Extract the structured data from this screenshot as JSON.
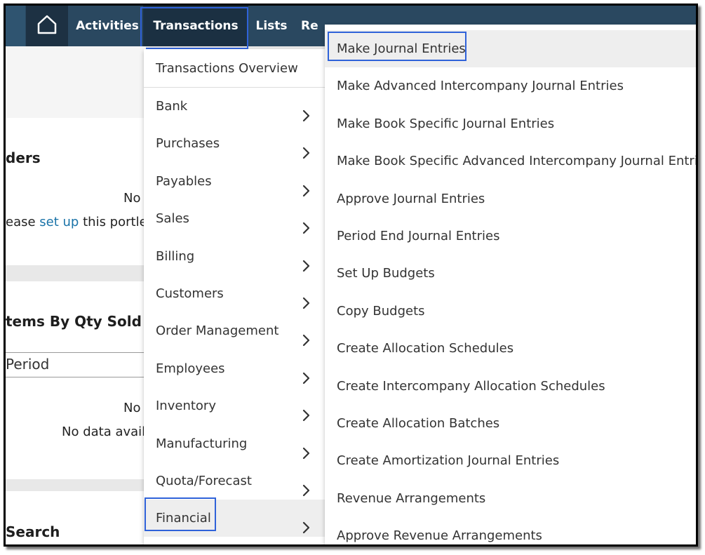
{
  "nav": {
    "items": [
      {
        "label": "Activities"
      },
      {
        "label": "Transactions"
      },
      {
        "label": "Lists"
      },
      {
        "label": "Re"
      }
    ]
  },
  "background": {
    "reminders_title": "ders",
    "no_text_1": "No",
    "setup_prefix": "ease",
    "setup_link": "set up",
    "setup_suffix": "this portlet b",
    "items_title": "tems By Qty Sold",
    "period_value": "Period",
    "no_text_2": "No",
    "no_data": "No data availa",
    "search_title": "Search"
  },
  "menu": {
    "overview": "Transactions Overview",
    "items": [
      {
        "label": "Bank"
      },
      {
        "label": "Purchases"
      },
      {
        "label": "Payables"
      },
      {
        "label": "Sales"
      },
      {
        "label": "Billing"
      },
      {
        "label": "Customers"
      },
      {
        "label": "Order Management"
      },
      {
        "label": "Employees"
      },
      {
        "label": "Inventory"
      },
      {
        "label": "Manufacturing"
      },
      {
        "label": "Quota/Forecast"
      },
      {
        "label": "Financial"
      }
    ]
  },
  "submenu": {
    "items": [
      {
        "label": "Make Journal Entries"
      },
      {
        "label": "Make Advanced Intercompany Journal Entries"
      },
      {
        "label": "Make Book Specific Journal Entries"
      },
      {
        "label": "Make Book Specific Advanced Intercompany Journal Entries"
      },
      {
        "label": "Approve Journal Entries"
      },
      {
        "label": "Period End Journal Entries"
      },
      {
        "label": "Set Up Budgets"
      },
      {
        "label": "Copy Budgets"
      },
      {
        "label": "Create Allocation Schedules"
      },
      {
        "label": "Create Intercompany Allocation Schedules"
      },
      {
        "label": "Create Allocation Batches"
      },
      {
        "label": "Create Amortization Journal Entries"
      },
      {
        "label": "Revenue Arrangements"
      },
      {
        "label": "Approve Revenue Arrangements"
      }
    ]
  },
  "colors": {
    "navbar": "#2a4860",
    "nav_active": "#1b3042",
    "highlight_border": "#2f62d9",
    "link": "#1a73a8"
  }
}
